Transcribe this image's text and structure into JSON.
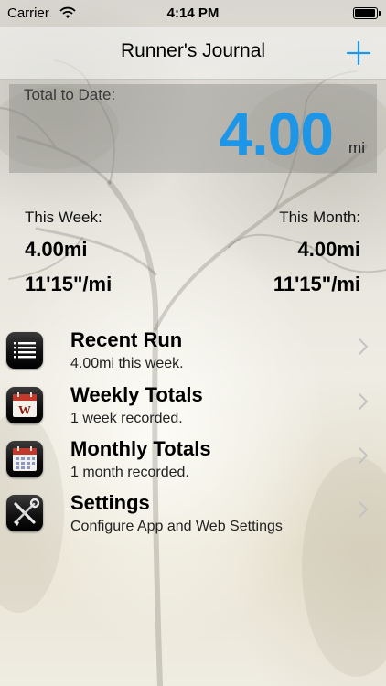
{
  "status_bar": {
    "carrier": "Carrier",
    "time": "4:14 PM",
    "wifi_icon": "wifi-icon",
    "battery_icon": "battery-icon"
  },
  "nav": {
    "title": "Runner's Journal",
    "add_icon": "plus-icon",
    "accent_color": "#1e96e8"
  },
  "total": {
    "label": "Total to Date:",
    "value": "4.00",
    "unit": "mi"
  },
  "summary": {
    "week": {
      "label": "This Week:",
      "distance": "4.00mi",
      "pace": "11'15\"/mi"
    },
    "month": {
      "label": "This Month:",
      "distance": "4.00mi",
      "pace": "11'15\"/mi"
    }
  },
  "menu": [
    {
      "title": "Recent Run",
      "subtitle": "4.00mi this week.",
      "icon": "list-icon"
    },
    {
      "title": "Weekly Totals",
      "subtitle": "1 week recorded.",
      "icon": "weekly-calendar-icon",
      "icon_letter": "W"
    },
    {
      "title": "Monthly Totals",
      "subtitle": "1 month recorded.",
      "icon": "monthly-calendar-icon"
    },
    {
      "title": "Settings",
      "subtitle": "Configure App and Web Settings",
      "icon": "tools-icon"
    }
  ]
}
